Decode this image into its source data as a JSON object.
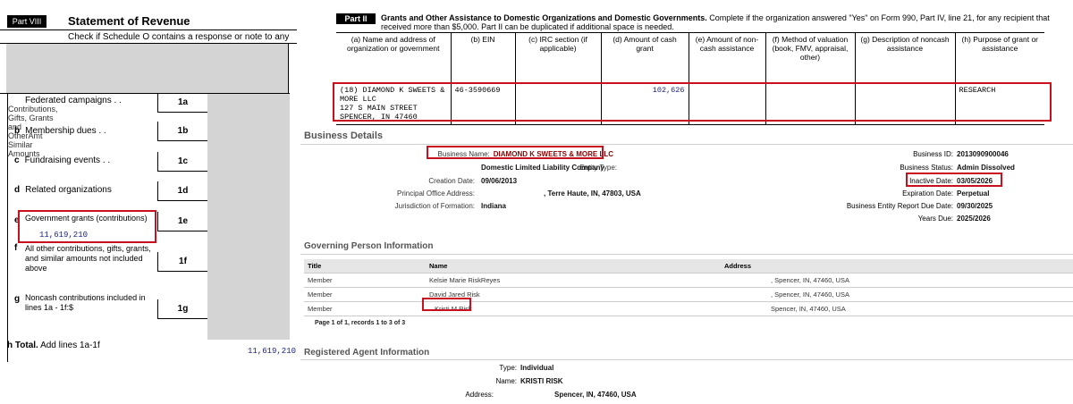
{
  "left": {
    "part_label": "Part VIII",
    "title": "Statement of Revenue",
    "check_text": "Check if Schedule O contains a response or note to any",
    "broken_image_alt": [
      "Contributions,",
      "Gifts, Grants",
      "and",
      "OtherAmt",
      "Similar",
      "Amounts"
    ],
    "rows": [
      {
        "letter": "a",
        "label": "Federated campaigns  .   .",
        "code": "1a"
      },
      {
        "letter": "b",
        "label": "Membership dues  .   .",
        "code": "1b"
      },
      {
        "letter": "c",
        "label": "Fundraising events  .   .",
        "code": "1c"
      },
      {
        "letter": "d",
        "label": "Related organizations",
        "code": "1d"
      },
      {
        "letter": "e",
        "label": "Government grants (contributions)",
        "code": "1e",
        "value": "11,619,210"
      },
      {
        "letter": "f",
        "label_lines": [
          "All other contributions, gifts, grants,",
          "and similar amounts not included",
          "above"
        ],
        "code": "1f"
      },
      {
        "letter": "g",
        "label_lines": [
          "Noncash contributions included in",
          "lines 1a - 1f:$"
        ],
        "code": "1g"
      }
    ],
    "total_letter": "h",
    "total_label": "Total.",
    "total_rest": "Add lines 1a-1f",
    "total_value": "11,619,210"
  },
  "part2": {
    "part_label": "Part II",
    "title_bold": "Grants and Other Assistance to Domestic Organizations and Domestic Governments.",
    "title_rest": "Complete if the organization answered \"Yes\" on Form 990, Part IV, line 21, for any recipient that received more than $5,000. Part II can be duplicated if additional space is needed.",
    "columns": [
      "(a) Name and address of organization or government",
      "(b) EIN",
      "(c) IRC section (if applicable)",
      "(d) Amount of cash grant",
      "(e) Amount of non-cash assistance",
      "(f) Method of valuation (book, FMV, appraisal, other)",
      "(g) Description of noncash assistance",
      "(h) Purpose of grant or assistance"
    ],
    "row": {
      "name_lines": [
        "(18) DIAMOND K SWEETS &",
        "MORE LLC",
        "127 S MAIN STREET",
        "SPENCER, IN  47460"
      ],
      "ein": "46-3590669",
      "irc": "",
      "cash": "102,626",
      "noncash": "",
      "method": "",
      "desc": "",
      "purpose": "RESEARCH"
    }
  },
  "business": {
    "section_title": "Business Details",
    "left_fields": [
      {
        "k": "Business Name:",
        "v": "DIAMOND K SWEETS & MORE LLC"
      },
      {
        "k": "Entity Type:",
        "v": "Domestic Limited Liability Company"
      },
      {
        "k": "Creation Date:",
        "v": "09/06/2013"
      },
      {
        "k": "Principal Office Address:",
        "v": ", Terre Haute, IN, 47803, USA"
      },
      {
        "k": "Jurisdiction of Formation:",
        "v": "Indiana"
      }
    ],
    "right_fields": [
      {
        "k": "Business ID:",
        "v": "2013090900046"
      },
      {
        "k": "Business Status:",
        "v": "Admin Dissolved"
      },
      {
        "k": "Inactive Date:",
        "v": "03/05/2026"
      },
      {
        "k": "Expiration Date:",
        "v": "Perpetual"
      },
      {
        "k": "Business Entity Report Due Date:",
        "v": "09/30/2025"
      },
      {
        "k": "Years Due:",
        "v": "2025/2026"
      }
    ]
  },
  "governing": {
    "section_title": "Governing Person Information",
    "headers": [
      "Title",
      "Name",
      "Address"
    ],
    "rows": [
      {
        "title": "Member",
        "name": "Kelsie Marie RiskReyes",
        "address": ", Spencer, IN, 47460, USA"
      },
      {
        "title": "Member",
        "name": "David Jared Risk",
        "address": ", Spencer, IN, 47460, USA"
      },
      {
        "title": "Member",
        "name": "Kristi M Risk",
        "address": "Spencer, IN, 47460, USA"
      }
    ],
    "pager": "Page 1 of 1, records 1 to 3 of 3"
  },
  "agent": {
    "section_title": "Registered Agent Information",
    "fields": [
      {
        "k": "Type:",
        "v": "Individual"
      },
      {
        "k": "Name:",
        "v": "KRISTI RISK"
      },
      {
        "k": "Address:",
        "v": "Spencer, IN, 47460, USA"
      }
    ]
  },
  "colors": {
    "highlight": "#c8101e",
    "value_blue": "#1a237e"
  }
}
